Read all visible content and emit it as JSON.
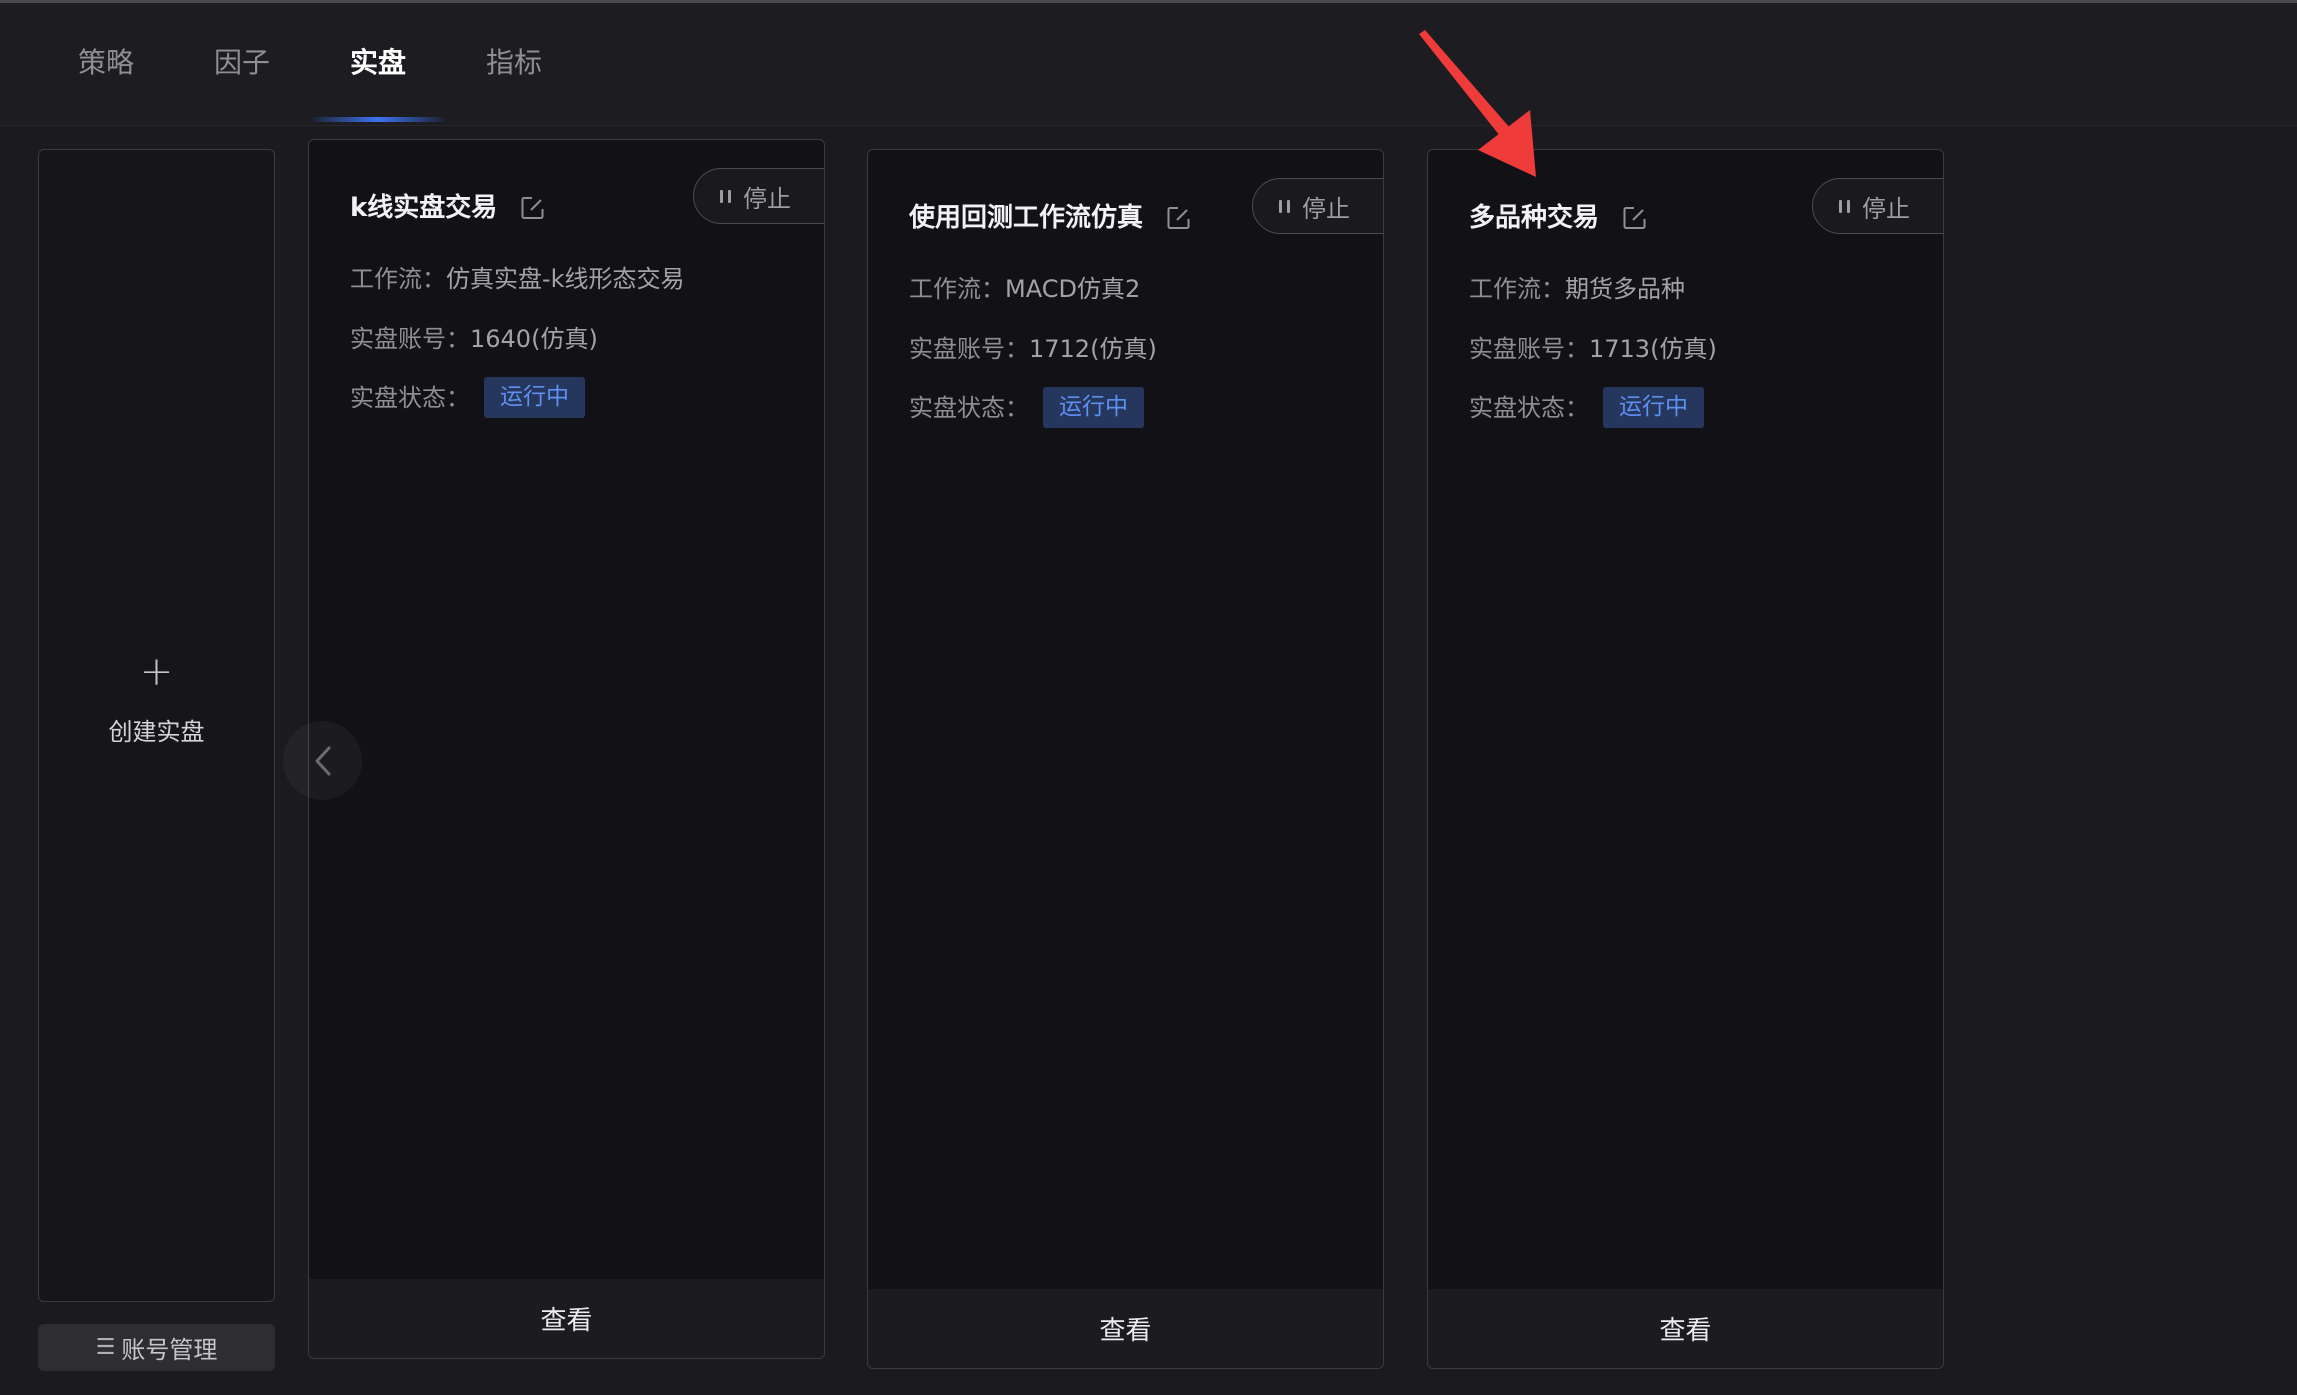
{
  "tabs": [
    {
      "label": "策略"
    },
    {
      "label": "因子"
    },
    {
      "label": "实盘",
      "active": true
    },
    {
      "label": "指标"
    }
  ],
  "create": {
    "icon": "plus-icon",
    "label": "创建实盘"
  },
  "account_manage": {
    "icon": "list-icon",
    "label": "账号管理"
  },
  "nav": {
    "prev_icon": "chevron-left-icon"
  },
  "cards": [
    {
      "title": "k线实盘交易",
      "stop_label": "停止",
      "workflow_label": "工作流：",
      "workflow": "仿真实盘-k线形态交易",
      "account_label": "实盘账号：",
      "account": "1640(仿真)",
      "status_label": "实盘状态：",
      "status": "运行中",
      "view_label": "查看"
    },
    {
      "title": "使用回测工作流仿真",
      "stop_label": "停止",
      "workflow_label": "工作流：",
      "workflow": "MACD仿真2",
      "account_label": "实盘账号：",
      "account": "1712(仿真)",
      "status_label": "实盘状态：",
      "status": "运行中",
      "view_label": "查看"
    },
    {
      "title": "多品种交易",
      "stop_label": "停止",
      "workflow_label": "工作流：",
      "workflow": "期货多品种",
      "account_label": "实盘账号：",
      "account": "1713(仿真)",
      "status_label": "实盘状态：",
      "status": "运行中",
      "view_label": "查看"
    }
  ],
  "colors": {
    "background": "#1b1b1f",
    "card_background": "#121216",
    "accent": "#3d73f0",
    "badge_background": "#26375d",
    "badge_text": "#5f8ff0",
    "annotation_arrow": "#f03b3b"
  }
}
